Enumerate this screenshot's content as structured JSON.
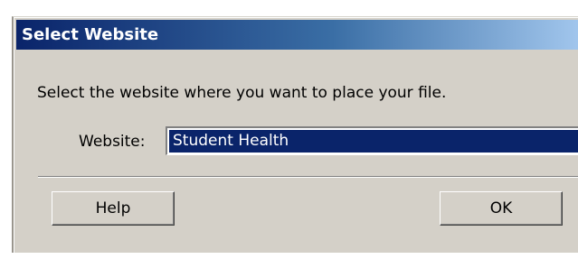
{
  "dialog": {
    "title": "Select Website",
    "prompt": "Select the website where you want to place your file.",
    "website_label": "Website:",
    "website_value": "Student Health",
    "help_label": "Help",
    "ok_label": "OK"
  },
  "colors": {
    "title_bar_start": "#0a246a",
    "title_bar_end": "#a6caf0",
    "dialog_face": "#d4d0c8",
    "selection": "#0a246a"
  }
}
